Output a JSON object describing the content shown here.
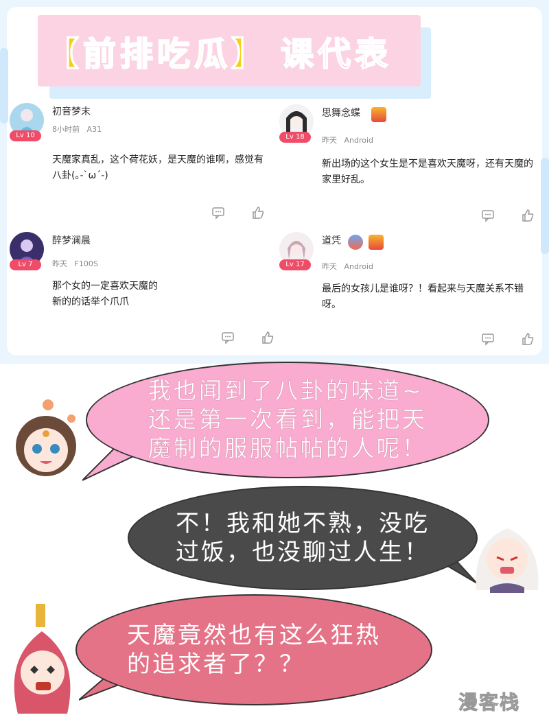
{
  "title": {
    "part1": "【前排吃瓜】",
    "part2": "课代表"
  },
  "comments": [
    {
      "name": "初音梦末",
      "level": "Lv 10",
      "time": "8小时前",
      "device": "A31",
      "text": "天魔家真乱，这个荷花妖，是天魔的谁啊，感觉有八卦(｡-`ω´-)"
    },
    {
      "name": "思舞念蝶",
      "level": "Lv 18",
      "time": "昨天",
      "device": "Android",
      "text": "新出场的这个女生是不是喜欢天魔呀，还有天魔的家里好乱。",
      "badges": [
        "8"
      ]
    },
    {
      "name": "醉梦澜晨",
      "level": "Lv 7",
      "time": "昨天",
      "device": "F100S",
      "text": "那个女的一定喜欢天魔的\n新的的话举个爪爪"
    },
    {
      "name": "道凭",
      "level": "Lv 17",
      "time": "昨天",
      "device": "Android",
      "text": "最后的女孩儿是谁呀？！看起来与天魔关系不错呀。",
      "badges": [
        "6",
        "9"
      ]
    }
  ],
  "bubbles": [
    {
      "text": "我也闻到了八卦的味道~\n还是第一次看到，能把天\n魔制的服服帖帖的人呢！",
      "fill": "#f9acd0",
      "text_color": "#ffffff"
    },
    {
      "text": "不！我和她不熟，没吃\n过饭，也没聊过人生！",
      "fill": "#4a4a4a",
      "text_color": "#ffffff"
    },
    {
      "text": "天魔竟然也有这么狂热\n的追求者了？？",
      "fill": "#e57388",
      "text_color": "#ffffff"
    }
  ],
  "watermark": "漫客栈",
  "colors": {
    "accent_pink": "#fbd3e3",
    "title_yellow": "#f7ce17",
    "level_red": "#ef4c68"
  }
}
